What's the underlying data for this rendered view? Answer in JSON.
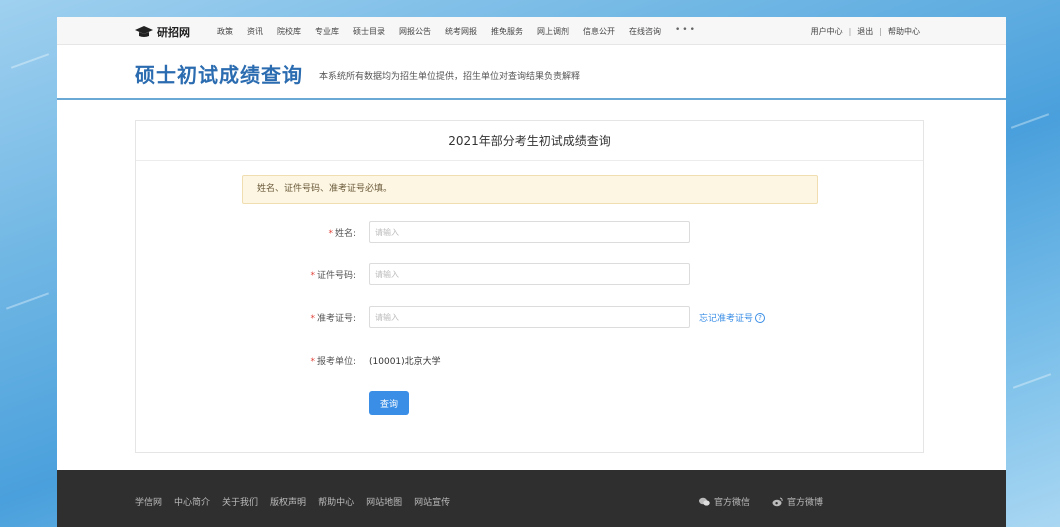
{
  "topnav": {
    "logo_text": "研招网",
    "items": [
      "政策",
      "资讯",
      "院校库",
      "专业库",
      "硕士目录",
      "网报公告",
      "统考网报",
      "推免服务",
      "网上调剂",
      "信息公开",
      "在线咨询"
    ],
    "more": "•••",
    "user_center": "用户中心",
    "logout": "退出",
    "help": "帮助中心"
  },
  "header": {
    "title": "硕士初试成绩查询",
    "subtitle": "本系统所有数据均为招生单位提供，招生单位对查询结果负责解释"
  },
  "card": {
    "title": "2021年部分考生初试成绩查询",
    "alert": "姓名、证件号码、准考证号必填。"
  },
  "form": {
    "name": {
      "label": "姓名:",
      "placeholder": "请输入"
    },
    "id_number": {
      "label": "证件号码:",
      "placeholder": "请输入"
    },
    "exam_number": {
      "label": "准考证号:",
      "placeholder": "请输入",
      "forgot": "忘记准考证号"
    },
    "unit": {
      "label": "报考单位:",
      "value": "(10001)北京大学"
    },
    "submit": "查询"
  },
  "footer": {
    "links": [
      "学信网",
      "中心简介",
      "关于我们",
      "版权声明",
      "帮助中心",
      "网站地图",
      "网站宣传"
    ],
    "wechat": "官方微信",
    "weibo": "官方微博"
  },
  "colors": {
    "brand_blue": "#2b6cb0",
    "button_blue": "#3a8ee6",
    "required_red": "#e0443a",
    "alert_bg": "#fdf6e3",
    "footer_bg": "#2f2f2f"
  }
}
